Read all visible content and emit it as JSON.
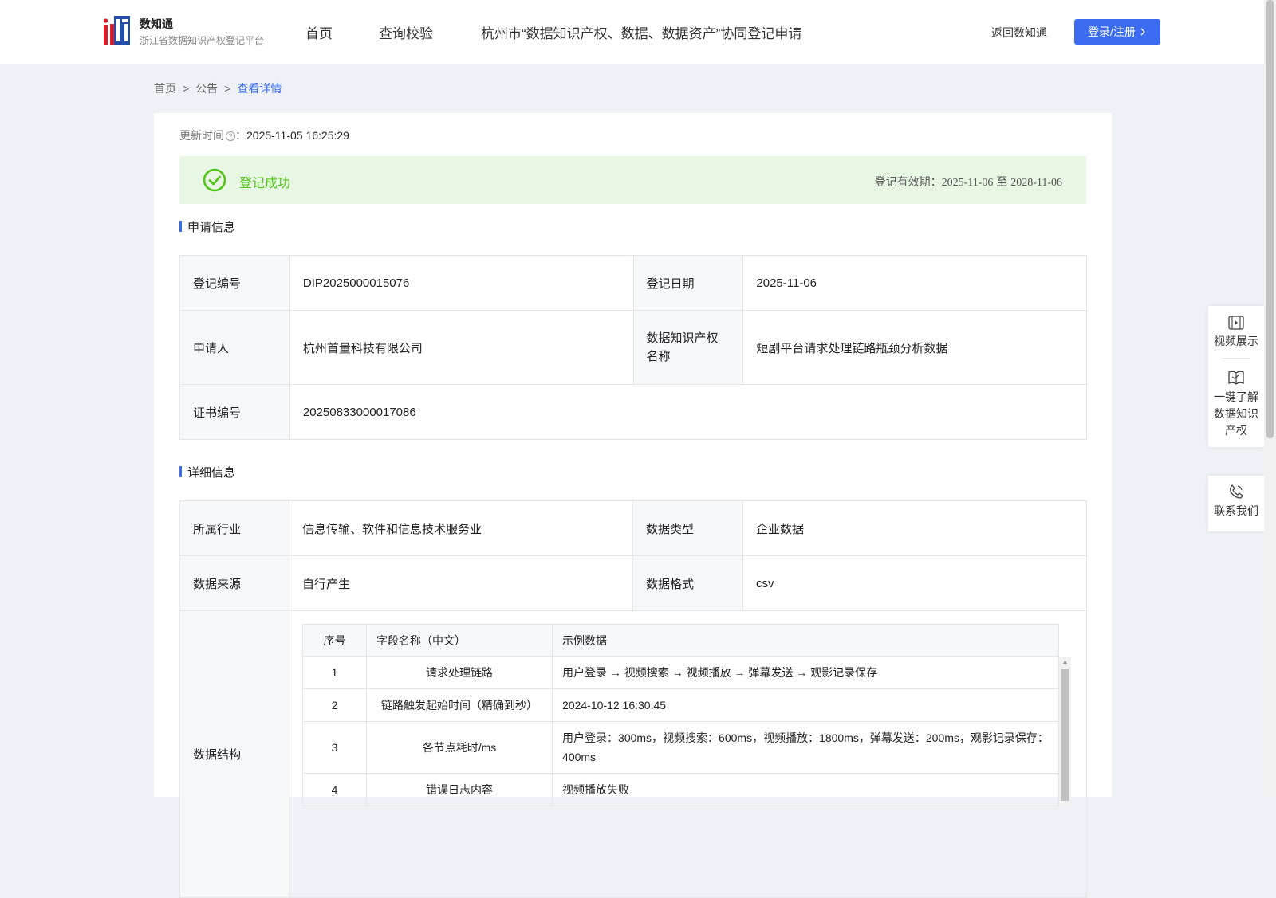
{
  "header": {
    "brand_name": "数知通",
    "brand_sub": "浙江省数据知识产权登记平台",
    "nav": [
      "首页",
      "查询校验",
      "杭州市“数据知识产权、数据、数据资产”协同登记申请"
    ],
    "back_link": "返回数知通",
    "login_button": "登录/注册"
  },
  "breadcrumb": {
    "home": "首页",
    "notice": "公告",
    "current": "查看详情",
    "sep": ">"
  },
  "update": {
    "label": "更新时间",
    "colon": "：",
    "value": "2025-11-05 16:25:29"
  },
  "status": {
    "text": "登记成功",
    "validity_label": "登记有效期：",
    "start": "2025-11-06",
    "to": "至",
    "end": "2028-11-06",
    "color": "#52c41a"
  },
  "apply_section": {
    "title": "申请信息",
    "reg_no_label": "登记编号",
    "reg_no": "DIP2025000015076",
    "reg_date_label": "登记日期",
    "reg_date": "2025-11-06",
    "applicant_label": "申请人",
    "applicant": "杭州首量科技有限公司",
    "ip_name_label": "数据知识产权名称",
    "ip_name": "短剧平台请求处理链路瓶颈分析数据",
    "cert_no_label": "证书编号",
    "cert_no": "20250833000017086"
  },
  "detail_section": {
    "title": "详细信息",
    "industry_label": "所属行业",
    "industry": "信息传输、软件和信息技术服务业",
    "data_type_label": "数据类型",
    "data_type": "企业数据",
    "source_label": "数据来源",
    "source": "自行产生",
    "format_label": "数据格式",
    "format": "csv",
    "structure_label": "数据结构",
    "fields_headers": [
      "序号",
      "字段名称（中文）",
      "示例数据"
    ],
    "fields": [
      {
        "no": "1",
        "name": "请求处理链路",
        "sample": "用户登录 → 视频搜索 → 视频播放 → 弹幕发送 → 观影记录保存"
      },
      {
        "no": "2",
        "name": "链路触发起始时间（精确到秒）",
        "sample": "2024-10-12 16:30:45"
      },
      {
        "no": "3",
        "name": "各节点耗时/ms",
        "sample": "用户登录：300ms，视频搜索：600ms，视频播放：1800ms，弹幕发送：200ms，观影记录保存：400ms"
      },
      {
        "no": "4",
        "name": "错误日志内容",
        "sample": "视频播放失败"
      }
    ]
  },
  "side_panel": {
    "video": "视频展示",
    "learn": "一键了解数据知识产权",
    "contact": "联系我们"
  },
  "colors": {
    "accent": "#3b6cf0",
    "success_bg": "#e8f7e3"
  }
}
